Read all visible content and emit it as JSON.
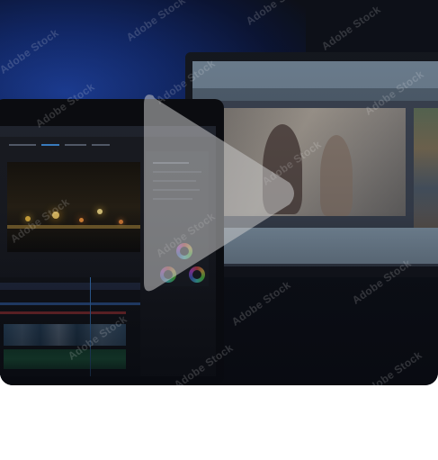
{
  "watermark": {
    "text": "Adobe Stock"
  },
  "video": {
    "play_icon": "play-icon",
    "accent_color": "#c8c8c8"
  }
}
